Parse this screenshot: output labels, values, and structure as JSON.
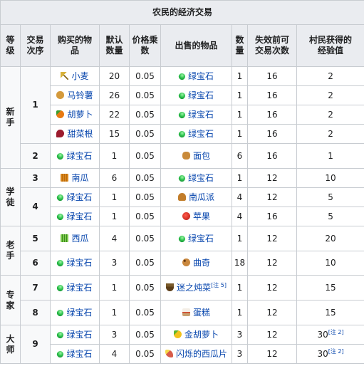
{
  "caption": "农民的经济交易",
  "headers": {
    "level": "等\n级",
    "index": "交易\n次序",
    "buy": "购买的物\n品",
    "qty": "默认\n数量",
    "mult": "价格乘\n数",
    "sell": "出售的物品",
    "sell_qty": "数\n量",
    "max_uses": "失效前可\n交易次数",
    "xp": "村民获得的\n经验值"
  },
  "levels": [
    "新\n手",
    "学\n徒",
    "老\n手",
    "专\n家",
    "大\n师"
  ],
  "rows": [
    {
      "idx": "1",
      "buy": "小麦",
      "buy_icon": "wheat-icon",
      "qty": "20",
      "mult": "0.05",
      "sell": "绿宝石",
      "sell_icon": "emerald-icon",
      "sell_qty": "1",
      "uses": "16",
      "xp": "2"
    },
    {
      "buy": "马铃薯",
      "buy_icon": "potato-icon",
      "qty": "26",
      "mult": "0.05",
      "sell": "绿宝石",
      "sell_icon": "emerald-icon",
      "sell_qty": "1",
      "uses": "16",
      "xp": "2"
    },
    {
      "buy": "胡萝卜",
      "buy_icon": "carrot-icon",
      "qty": "22",
      "mult": "0.05",
      "sell": "绿宝石",
      "sell_icon": "emerald-icon",
      "sell_qty": "1",
      "uses": "16",
      "xp": "2"
    },
    {
      "buy": "甜菜根",
      "buy_icon": "beetroot-icon",
      "qty": "15",
      "mult": "0.05",
      "sell": "绿宝石",
      "sell_icon": "emerald-icon",
      "sell_qty": "1",
      "uses": "16",
      "xp": "2"
    },
    {
      "idx": "2",
      "buy": "绿宝石",
      "buy_icon": "emerald-icon",
      "qty": "1",
      "mult": "0.05",
      "sell": "面包",
      "sell_icon": "bread-icon",
      "sell_qty": "6",
      "uses": "16",
      "xp": "1"
    },
    {
      "idx": "3",
      "buy": "南瓜",
      "buy_icon": "pumpkin-icon",
      "qty": "6",
      "mult": "0.05",
      "sell": "绿宝石",
      "sell_icon": "emerald-icon",
      "sell_qty": "1",
      "uses": "12",
      "xp": "10"
    },
    {
      "idx": "4",
      "buy": "绿宝石",
      "buy_icon": "emerald-icon",
      "qty": "1",
      "mult": "0.05",
      "sell": "南瓜派",
      "sell_icon": "pumpkin-pie-icon",
      "sell_qty": "4",
      "uses": "12",
      "xp": "5"
    },
    {
      "buy": "绿宝石",
      "buy_icon": "emerald-icon",
      "qty": "1",
      "mult": "0.05",
      "sell": "苹果",
      "sell_icon": "apple-icon",
      "sell_qty": "4",
      "uses": "16",
      "xp": "5"
    },
    {
      "idx": "5",
      "buy": "西瓜",
      "buy_icon": "melon-icon",
      "qty": "4",
      "mult": "0.05",
      "sell": "绿宝石",
      "sell_icon": "emerald-icon",
      "sell_qty": "1",
      "uses": "12",
      "xp": "20"
    },
    {
      "idx": "6",
      "buy": "绿宝石",
      "buy_icon": "emerald-icon",
      "qty": "3",
      "mult": "0.05",
      "sell": "曲奇",
      "sell_icon": "cookie-icon",
      "sell_qty": "18",
      "uses": "12",
      "xp": "10"
    },
    {
      "idx": "7",
      "buy": "绿宝石",
      "buy_icon": "emerald-icon",
      "qty": "1",
      "mult": "0.05",
      "sell": "迷之炖菜",
      "sell_icon": "stew-icon",
      "sell_note": "[注 5]",
      "sell_qty": "1",
      "uses": "12",
      "xp": "15"
    },
    {
      "idx": "8",
      "buy": "绿宝石",
      "buy_icon": "emerald-icon",
      "qty": "1",
      "mult": "0.05",
      "sell": "蛋糕",
      "sell_icon": "cake-icon",
      "sell_qty": "1",
      "uses": "12",
      "xp": "15"
    },
    {
      "idx": "9",
      "buy": "绿宝石",
      "buy_icon": "emerald-icon",
      "qty": "3",
      "mult": "0.05",
      "sell": "金胡萝卜",
      "sell_icon": "golden-carrot-icon",
      "sell_qty": "3",
      "uses": "12",
      "xp": "30",
      "xp_note": "[注 2]"
    },
    {
      "buy": "绿宝石",
      "buy_icon": "emerald-icon",
      "qty": "4",
      "mult": "0.05",
      "sell": "闪烁的西瓜片",
      "sell_icon": "glistering-melon-icon",
      "sell_qty": "3",
      "uses": "12",
      "xp": "30",
      "xp_note": "[注 2]"
    }
  ]
}
